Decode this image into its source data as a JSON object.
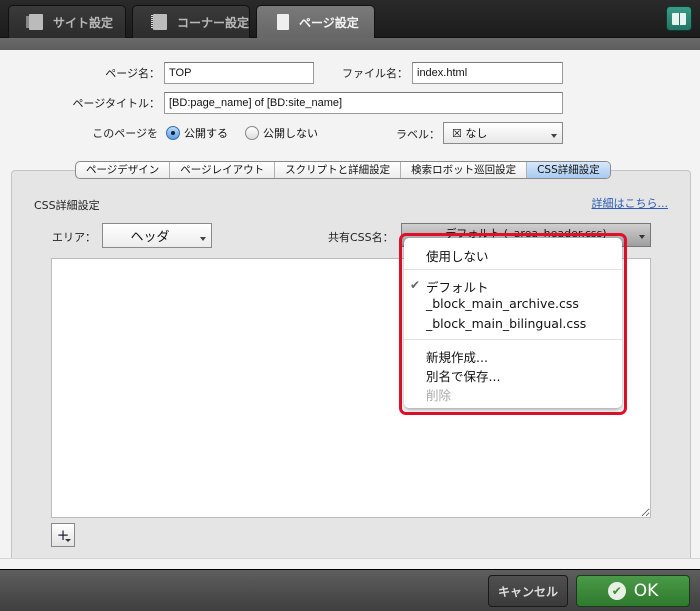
{
  "top_tabs": [
    {
      "label": "サイト設定",
      "icon": "book-stack-icon",
      "active": false
    },
    {
      "label": "コーナー設定",
      "icon": "spiral-notebook-icon",
      "active": false
    },
    {
      "label": "ページ設定",
      "icon": "page-icon",
      "active": true
    }
  ],
  "help_button": {
    "icon": "manual-book-icon"
  },
  "form": {
    "page_name_label": "ページ名：",
    "page_name_value": "TOP",
    "file_name_label": "ファイル名：",
    "file_name_value": "index.html",
    "page_title_label": "ページタイトル：",
    "page_title_value": "[BD:page_name] of [BD:site_name]",
    "publish_label": "このページを",
    "publish_options": [
      {
        "label": "公開する",
        "selected": true
      },
      {
        "label": "公開しない",
        "selected": false
      }
    ],
    "label_label": "ラベル：",
    "label_value": "☒ なし"
  },
  "sub_tabs": [
    {
      "label": "ページデザイン",
      "active": false
    },
    {
      "label": "ページレイアウト",
      "active": false
    },
    {
      "label": "スクリプトと詳細設定",
      "active": false
    },
    {
      "label": "検索ロボット巡回設定",
      "active": false
    },
    {
      "label": "CSS詳細設定",
      "active": true
    }
  ],
  "panel": {
    "title": "CSS詳細設定",
    "detail_link": "詳細はこちら...",
    "area_label": "エリア：",
    "area_value": "ヘッダ",
    "shared_css_label": "共有CSS名：",
    "shared_css_value": "デフォルト (_area_header.css)",
    "editor_value": "",
    "add_button": "+"
  },
  "dropdown": {
    "groups": [
      [
        {
          "label": "使用しない",
          "checked": false,
          "disabled": false
        }
      ],
      [
        {
          "label": "デフォルト",
          "checked": true,
          "disabled": false
        },
        {
          "label": "_block_main_archive.css",
          "checked": false,
          "disabled": false
        },
        {
          "label": "_block_main_bilingual.css",
          "checked": false,
          "disabled": false
        }
      ],
      [
        {
          "label": "新規作成...",
          "checked": false,
          "disabled": false
        },
        {
          "label": "別名で保存...",
          "checked": false,
          "disabled": false
        },
        {
          "label": "削除",
          "checked": false,
          "disabled": true
        }
      ]
    ],
    "check_glyph": "✔",
    "highlight_color": "#e0102a"
  },
  "footer": {
    "cancel_label": "キャンセル",
    "ok_label": "OK",
    "ok_color": "#3a8a38"
  }
}
